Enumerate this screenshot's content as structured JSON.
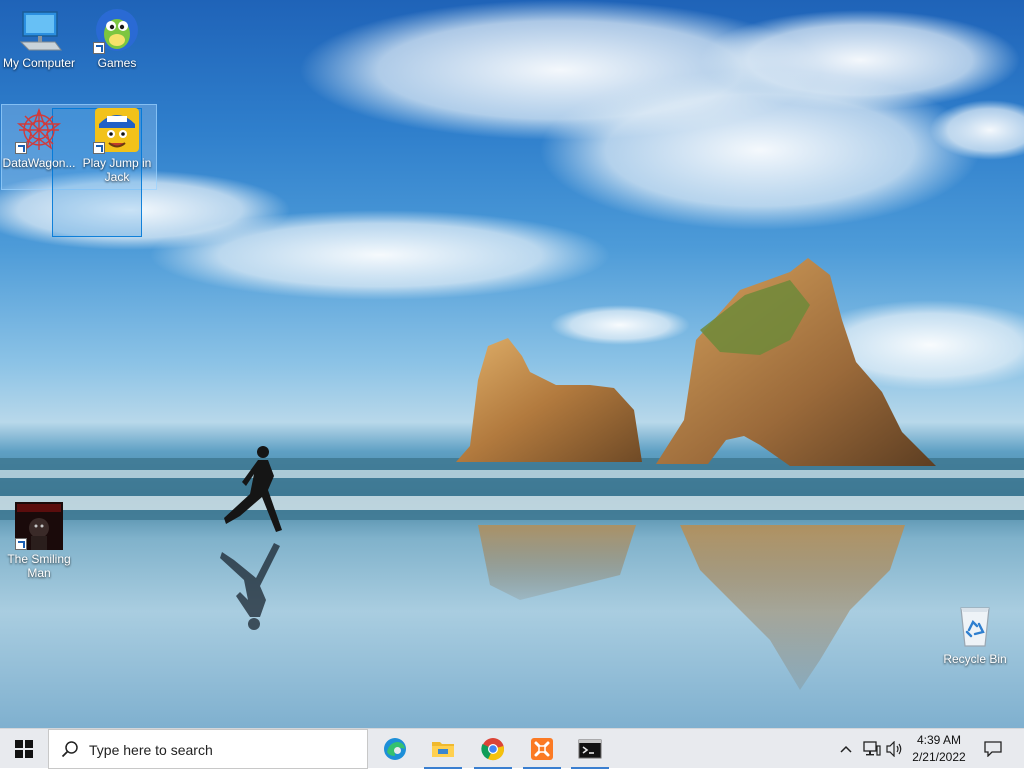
{
  "desktop": {
    "icons": [
      {
        "label": "My Computer"
      },
      {
        "label": "Games"
      },
      {
        "label": "DataWagon..."
      },
      {
        "label": "Play Jump in Jack"
      },
      {
        "label": "The Smiling Man"
      },
      {
        "label": "Recycle Bin"
      }
    ]
  },
  "taskbar": {
    "search_placeholder": "Type here to search",
    "apps": [
      {
        "icon": "edge-icon"
      },
      {
        "icon": "file-explorer-icon"
      },
      {
        "icon": "chrome-icon"
      },
      {
        "icon": "xampp-icon"
      },
      {
        "icon": "command-prompt-icon"
      }
    ],
    "clock": {
      "time": "4:39 AM",
      "date": "2/21/2022"
    }
  },
  "colors": {
    "accent": "#3a7fd0",
    "taskbar_bg": "#e8eaee"
  }
}
